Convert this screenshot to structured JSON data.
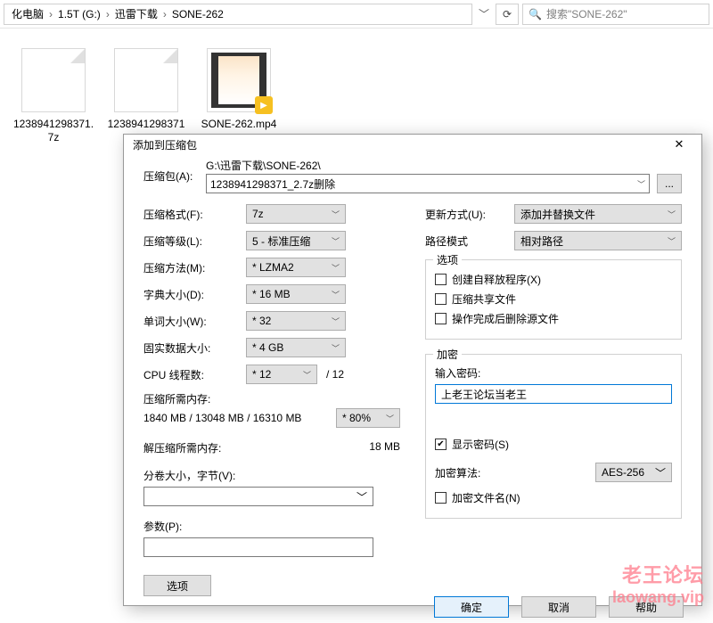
{
  "breadcrumb": {
    "items": [
      "化电脑",
      "1.5T (G:)",
      "迅雷下载",
      "SONE-262"
    ]
  },
  "search": {
    "placeholder": "搜索\"SONE-262\""
  },
  "files": [
    {
      "name": "1238941298371.7z",
      "kind": "archive"
    },
    {
      "name": "1238941298371",
      "kind": "doc"
    },
    {
      "name": "SONE-262.mp4",
      "kind": "video"
    }
  ],
  "dialog": {
    "title": "添加到压缩包",
    "archive_label": "压缩包(A):",
    "archive_dir": "G:\\迅雷下载\\SONE-262\\",
    "archive_name": "1238941298371_2.7z删除",
    "browse": "...",
    "left": {
      "format_label": "压缩格式(F):",
      "format_value": "7z",
      "level_label": "压缩等级(L):",
      "level_value": "5 - 标准压缩",
      "method_label": "压缩方法(M):",
      "method_value": "* LZMA2",
      "dict_label": "字典大小(D):",
      "dict_value": "* 16 MB",
      "word_label": "单词大小(W):",
      "word_value": "* 32",
      "solid_label": "固实数据大小:",
      "solid_value": "* 4 GB",
      "threads_label": "CPU 线程数:",
      "threads_value": "* 12",
      "threads_suffix": "/ 12",
      "mem_need_label": "压缩所需内存:",
      "mem_need_value": "1840 MB / 13048 MB / 16310 MB",
      "mem_pct": "* 80%",
      "decompress_mem_label": "解压缩所需内存:",
      "decompress_mem_value": "18 MB",
      "split_label": "分卷大小，字节(V):",
      "params_label": "参数(P):",
      "options_btn": "选项"
    },
    "right": {
      "update_label": "更新方式(U):",
      "update_value": "添加并替换文件",
      "path_label": "路径模式",
      "path_value": "相对路径",
      "options_legend": "选项",
      "opt_sfx": "创建自释放程序(X)",
      "opt_share": "压缩共享文件",
      "opt_delete": "操作完成后删除源文件",
      "encrypt_legend": "加密",
      "pwd_label": "输入密码:",
      "pwd_value": "上老王论坛当老王",
      "show_pwd": "显示密码(S)",
      "algo_label": "加密算法:",
      "algo_value": "AES-256",
      "encrypt_names": "加密文件名(N)"
    },
    "buttons": {
      "ok": "确定",
      "cancel": "取消",
      "help": "帮助"
    }
  },
  "watermark": {
    "line1": "老王论坛",
    "line2": "laowang.vip"
  }
}
